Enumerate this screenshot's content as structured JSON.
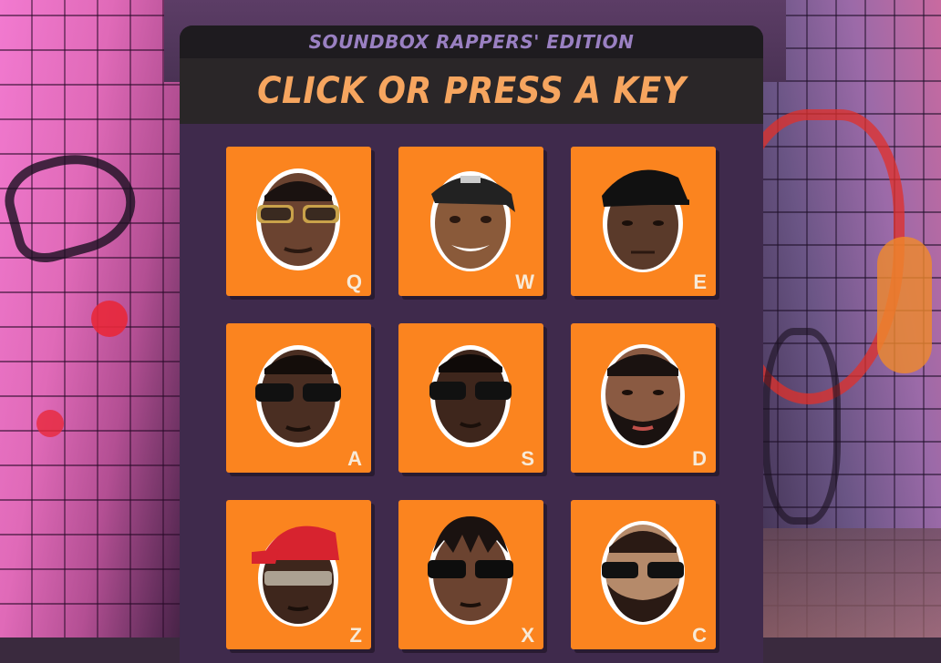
{
  "app": {
    "edition": "SOUNDBOX RAPPERS' EDITION",
    "instruction": "CLICK OR PRESS A KEY"
  },
  "colors": {
    "panel": "#3f2a4c",
    "pad": "#fb841f",
    "edition_text": "#9a80c2",
    "instruction_text": "#f6a55f"
  },
  "pads": [
    {
      "key": "Q",
      "icon": "rapper-face-gold-sunglasses"
    },
    {
      "key": "W",
      "icon": "rapper-face-bandana-cap"
    },
    {
      "key": "E",
      "icon": "rapper-face-black-cap"
    },
    {
      "key": "A",
      "icon": "rapper-face-dark-sunglasses"
    },
    {
      "key": "S",
      "icon": "rapper-face-sunglasses"
    },
    {
      "key": "D",
      "icon": "rapper-face-beard"
    },
    {
      "key": "Z",
      "icon": "rapper-face-red-cap"
    },
    {
      "key": "X",
      "icon": "rapper-face-braids-sunglasses"
    },
    {
      "key": "C",
      "icon": "rapper-face-beard-sunglasses"
    }
  ]
}
